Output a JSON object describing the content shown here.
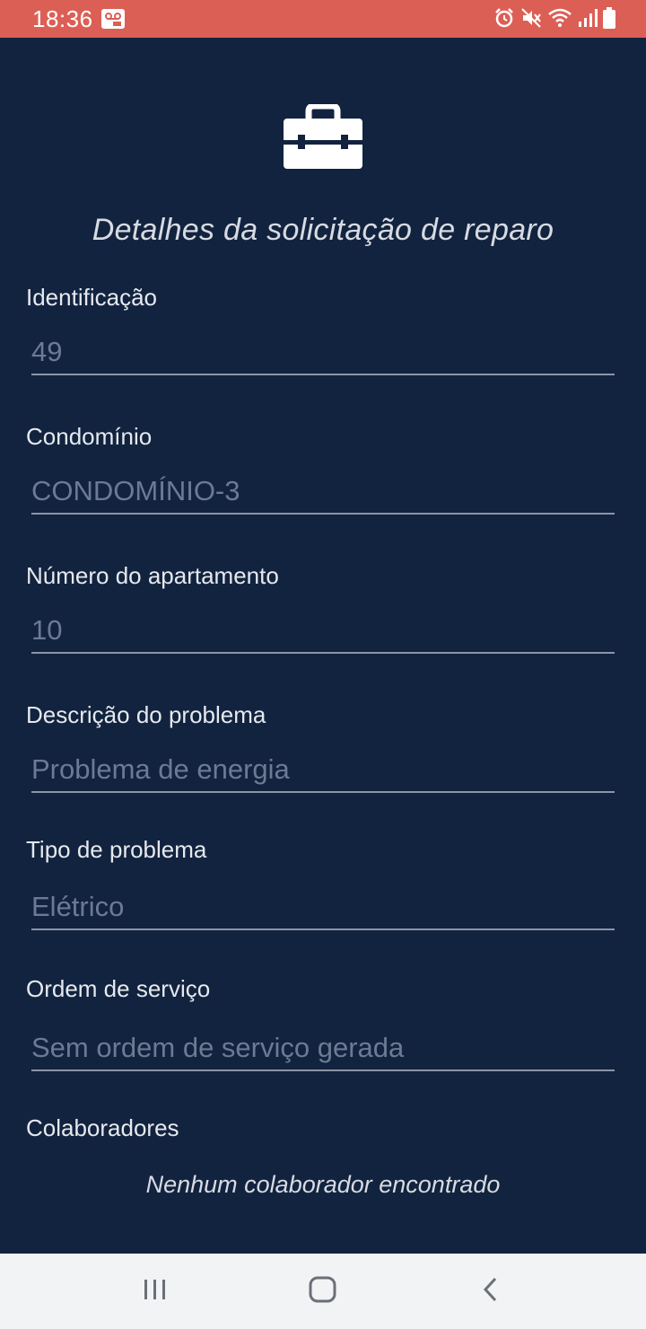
{
  "status_bar": {
    "time": "18:36",
    "left_icons": [
      "voicemail-icon"
    ],
    "right_icons": [
      "alarm-icon",
      "mute-icon",
      "wifi-icon",
      "signal-icon",
      "battery-icon"
    ],
    "background": "#dc5f56"
  },
  "header": {
    "icon": "toolbox-icon",
    "title": "Detalhes da solicitação de reparo"
  },
  "fields": [
    {
      "label": "Identificação",
      "value": "49"
    },
    {
      "label": "Condomínio",
      "value": "CONDOMÍNIO-3"
    },
    {
      "label": "Número do apartamento",
      "value": "10"
    },
    {
      "label": "Descrição do problema",
      "value": "Problema de energia"
    },
    {
      "label": "Tipo de problema",
      "value": "Elétrico"
    },
    {
      "label": "Ordem de serviço",
      "value": "Sem ordem de serviço gerada"
    }
  ],
  "collaborators": {
    "label": "Colaboradores",
    "empty_message": "Nenhum colaborador encontrado"
  },
  "nav_bar": {
    "buttons": [
      "recents-icon",
      "home-icon",
      "back-icon"
    ]
  },
  "colors": {
    "background": "#12233f",
    "label": "#e6e9ee",
    "value": "#6b7b93",
    "underline": "#8b95a6"
  }
}
